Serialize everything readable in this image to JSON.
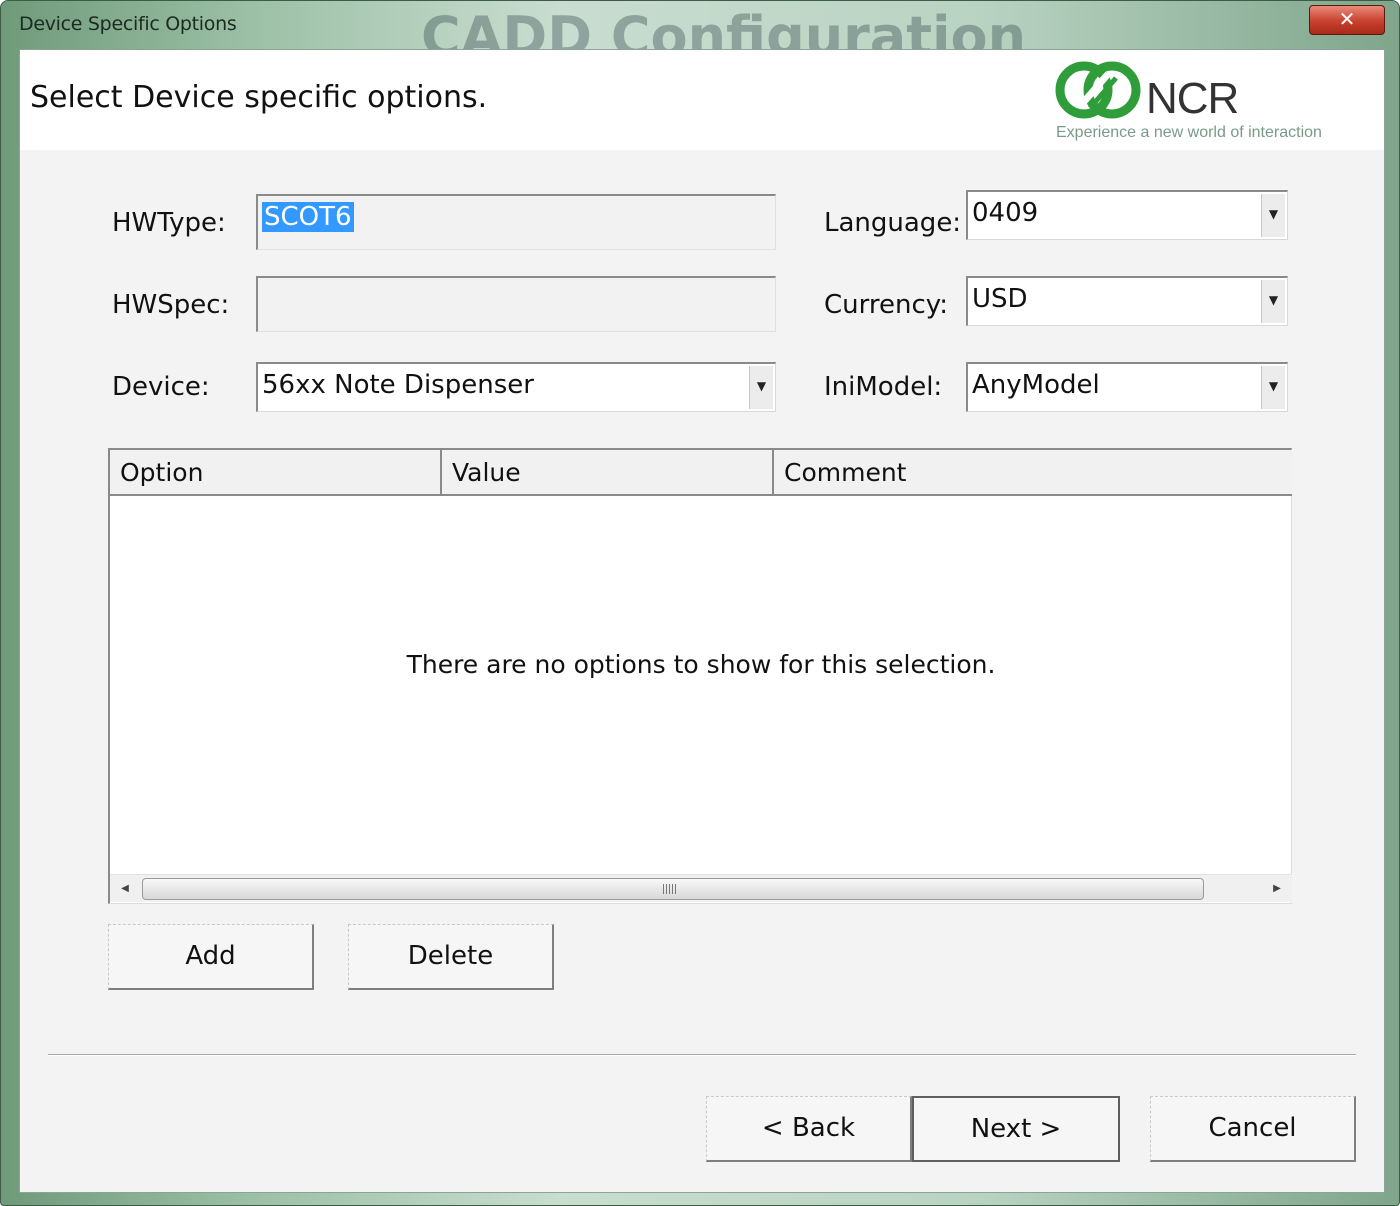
{
  "window": {
    "title": "Device Specific Options",
    "background_title": "CADD Configuration",
    "close_glyph": "✕"
  },
  "header": {
    "title": "Select Device specific options.",
    "logo_name": "NCR",
    "logo_tagline": "Experience a new world of interaction",
    "logo_color": "#2f9e3a"
  },
  "form": {
    "hwtype_label": "HWType:",
    "hwtype_value": "SCOT6",
    "hwspec_label": "HWSpec:",
    "hwspec_value": "",
    "device_label": "Device:",
    "device_value": "56xx Note Dispenser",
    "language_label": "Language:",
    "language_value": "0409",
    "currency_label": "Currency:",
    "currency_value": "USD",
    "inimodel_label": "IniModel:",
    "inimodel_value": "AnyModel"
  },
  "grid": {
    "columns": [
      "Option",
      "Value",
      "Comment"
    ],
    "empty_message": "There are no options to show for this selection."
  },
  "actions": {
    "add_label": "Add",
    "delete_label": "Delete"
  },
  "wizard": {
    "back_label": "< Back",
    "next_label": "Next >",
    "cancel_label": "Cancel"
  },
  "icons": {
    "dropdown": "chevron-down-icon",
    "scroll_left": "arrow-left-icon",
    "scroll_right": "arrow-right-icon"
  }
}
